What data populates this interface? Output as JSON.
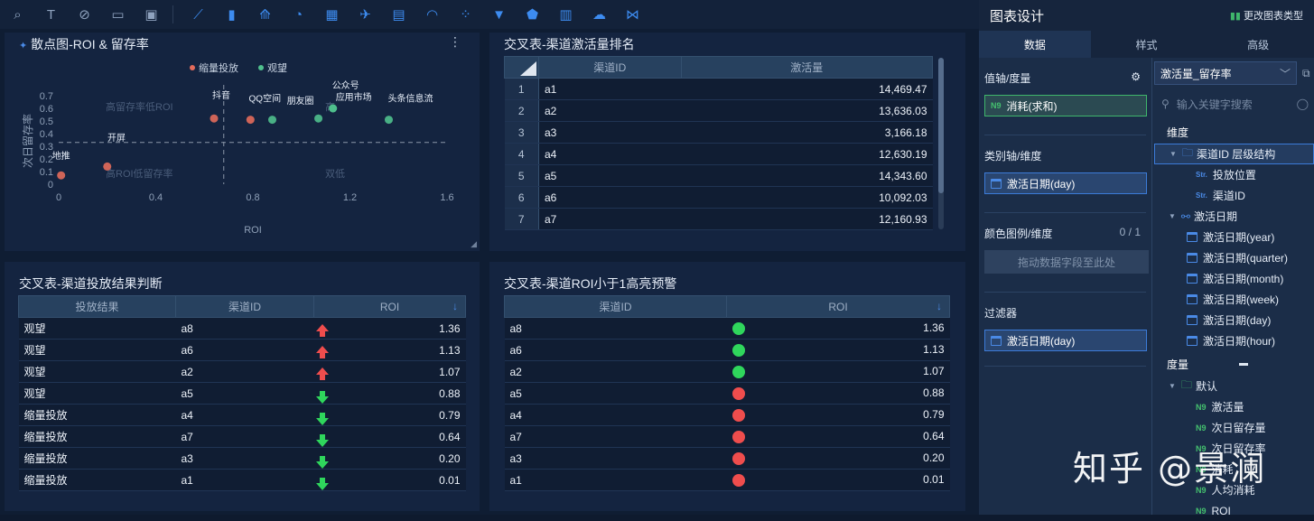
{
  "toolbar": {
    "icons": [
      "query-icon",
      "text-icon",
      "link-icon",
      "frame-icon",
      "image-icon",
      "line-chart-icon",
      "bar-chart-icon",
      "combo-chart-icon",
      "pie-chart-icon",
      "table-icon",
      "map-icon",
      "indicator-card-icon",
      "gauge-icon",
      "scatter-icon",
      "funnel-icon",
      "radar-icon",
      "crosstab-icon",
      "word-cloud-icon",
      "tree-icon"
    ]
  },
  "scatter": {
    "title": "散点图-ROI & 留存率",
    "legend": [
      {
        "name": "缩量投放",
        "color": "#e36b5b"
      },
      {
        "name": "观望",
        "color": "#4fc08d"
      }
    ],
    "ylabel": "次日留存率",
    "xlabel": "ROI",
    "quadrant_labels": [
      "高留存率低ROI",
      "高ROI低留存率",
      "双低",
      "高"
    ],
    "ref_labels": [
      "开屏"
    ],
    "chart_data": {
      "type": "scatter",
      "xlim": [
        0,
        1.6
      ],
      "ylim": [
        0,
        0.7
      ],
      "xticks": [
        "0",
        "0.4",
        "0.8",
        "1.2",
        "1.6"
      ],
      "yticks": [
        "0",
        "0.1",
        "0.2",
        "0.3",
        "0.4",
        "0.5",
        "0.6",
        "0.7"
      ],
      "points": [
        {
          "label": "地推",
          "x": 0.01,
          "y": 0.07,
          "group": "缩量投放"
        },
        {
          "label": "",
          "x": 0.2,
          "y": 0.14,
          "group": "缩量投放"
        },
        {
          "label": "抖音",
          "x": 0.64,
          "y": 0.52,
          "group": "缩量投放"
        },
        {
          "label": "QQ空间",
          "x": 0.79,
          "y": 0.51,
          "group": "缩量投放"
        },
        {
          "label": "",
          "x": 0.88,
          "y": 0.51,
          "group": "观望"
        },
        {
          "label": "朋友圈",
          "x": 1.07,
          "y": 0.52,
          "group": "观望"
        },
        {
          "label": "公众号",
          "x": 1.13,
          "y": 0.6,
          "group": "观望"
        },
        {
          "label": "应用市场",
          "x": 1.13,
          "y": 0.6,
          "group": "观望"
        },
        {
          "label": "头条信息流",
          "x": 1.36,
          "y": 0.51,
          "group": "观望"
        }
      ]
    }
  },
  "rank": {
    "title": "交叉表-渠道激活量排名",
    "headers": [
      "渠道ID",
      "激活量"
    ],
    "rows": [
      [
        "1",
        "a1",
        "14,469.47"
      ],
      [
        "2",
        "a2",
        "13,636.03"
      ],
      [
        "3",
        "a3",
        "3,166.18"
      ],
      [
        "4",
        "a4",
        "12,630.19"
      ],
      [
        "5",
        "a5",
        "14,343.60"
      ],
      [
        "6",
        "a6",
        "10,092.03"
      ],
      [
        "7",
        "a7",
        "12,160.93"
      ]
    ]
  },
  "judge": {
    "title": "交叉表-渠道投放结果判断",
    "headers": [
      "投放结果",
      "渠道ID",
      "ROI"
    ],
    "rows": [
      [
        "观望",
        "a8",
        "up",
        "1.36"
      ],
      [
        "观望",
        "a6",
        "up",
        "1.13"
      ],
      [
        "观望",
        "a2",
        "up",
        "1.07"
      ],
      [
        "观望",
        "a5",
        "down",
        "0.88"
      ],
      [
        "缩量投放",
        "a4",
        "down",
        "0.79"
      ],
      [
        "缩量投放",
        "a7",
        "down",
        "0.64"
      ],
      [
        "缩量投放",
        "a3",
        "down",
        "0.20"
      ],
      [
        "缩量投放",
        "a1",
        "down",
        "0.01"
      ]
    ]
  },
  "alert": {
    "title": "交叉表-渠道ROI小于1高亮预警",
    "headers": [
      "渠道ID",
      "ROI"
    ],
    "rows": [
      [
        "a8",
        "green",
        "1.36"
      ],
      [
        "a6",
        "green",
        "1.13"
      ],
      [
        "a2",
        "green",
        "1.07"
      ],
      [
        "a5",
        "red",
        "0.88"
      ],
      [
        "a4",
        "red",
        "0.79"
      ],
      [
        "a7",
        "red",
        "0.64"
      ],
      [
        "a3",
        "red",
        "0.20"
      ],
      [
        "a1",
        "red",
        "0.01"
      ]
    ]
  },
  "design": {
    "title": "图表设计",
    "change_type": "更改图表类型",
    "tabs": [
      "数据",
      "样式",
      "高级"
    ],
    "value_axis": "值轴/度量",
    "value_chip": "消耗(求和)",
    "category_axis": "类别轴/维度",
    "category_chip": "激活日期(day)",
    "color_legend": "颜色图例/维度",
    "color_count": "0 / 1",
    "drop_hint": "拖动数据字段至此处",
    "filter": "过滤器",
    "filter_chip": "激活日期(day)",
    "dataset": "激活量_留存率",
    "search_placeholder": "输入关键字搜索",
    "dim_label": "维度",
    "dim_items": [
      {
        "kind": "folder",
        "text": "渠道ID 层级结构"
      },
      {
        "kind": "str",
        "text": "投放位置"
      },
      {
        "kind": "str",
        "text": "渠道ID"
      },
      {
        "kind": "hier",
        "text": "激活日期"
      },
      {
        "kind": "date",
        "text": "激活日期(year)"
      },
      {
        "kind": "date",
        "text": "激活日期(quarter)"
      },
      {
        "kind": "date",
        "text": "激活日期(month)"
      },
      {
        "kind": "date",
        "text": "激活日期(week)"
      },
      {
        "kind": "date",
        "text": "激活日期(day)"
      },
      {
        "kind": "date",
        "text": "激活日期(hour)"
      }
    ],
    "measure_label": "度量",
    "measure_items": [
      {
        "kind": "folder",
        "text": "默认"
      },
      {
        "kind": "num",
        "text": "激活量"
      },
      {
        "kind": "num",
        "text": "次日留存量"
      },
      {
        "kind": "num",
        "text": "次日留存率"
      },
      {
        "kind": "num",
        "text": "消耗"
      },
      {
        "kind": "num",
        "text": "人均消耗"
      },
      {
        "kind": "num",
        "text": "ROI"
      }
    ]
  },
  "watermark": "知乎 @景澜"
}
